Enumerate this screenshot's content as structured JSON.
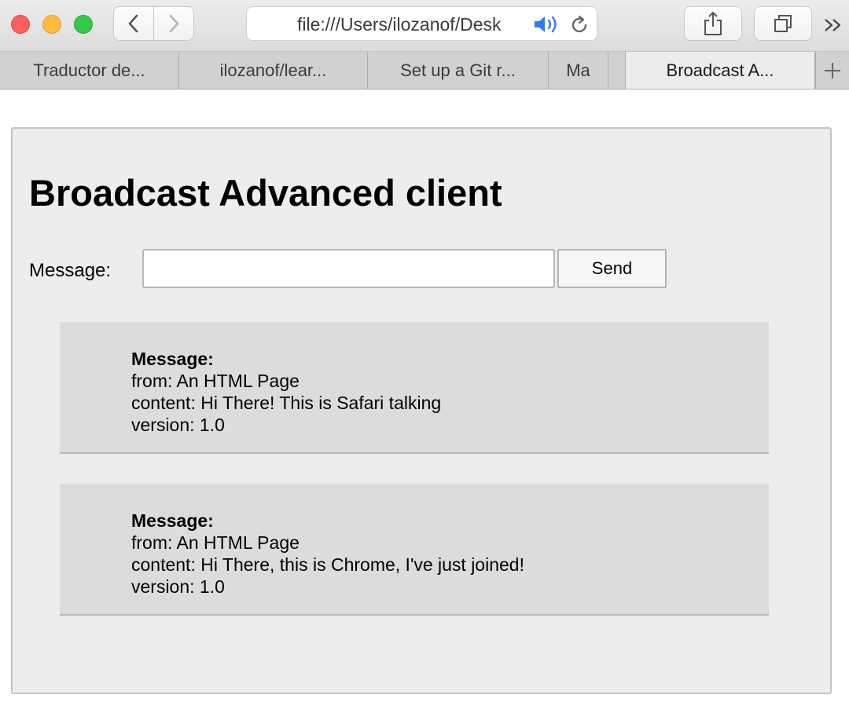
{
  "browser": {
    "address": "file:///Users/ilozanof/Desk",
    "tabs": [
      {
        "label": "Traductor de..."
      },
      {
        "label": "ilozanof/lear..."
      },
      {
        "label": "Set up a Git r..."
      },
      {
        "label": "Ma"
      },
      {
        "label": "Broadcast A...",
        "active": true
      }
    ],
    "icons": {
      "back": "chevron-left-icon",
      "forward": "chevron-right-icon",
      "sound": "speaker-icon",
      "reload": "reload-icon",
      "share": "share-icon",
      "tabs": "tab-overview-icon",
      "more": "double-chevron-right-icon",
      "new_tab": "plus-icon"
    },
    "colors": {
      "close": "#fc605c",
      "minimize": "#fdbc40",
      "zoom": "#34c84a",
      "sound_accent": "#2f7bf6"
    }
  },
  "page": {
    "title": "Broadcast Advanced client",
    "message_label": "Message:",
    "input_value": "",
    "send_label": "Send",
    "messages": [
      {
        "heading": "Message:",
        "from": "from: An HTML Page",
        "content": "content: Hi There! This is Safari talking",
        "version": "version: 1.0"
      },
      {
        "heading": "Message:",
        "from": "from: An HTML Page",
        "content": "content: Hi There, this is Chrome, I've just joined!",
        "version": "version: 1.0"
      }
    ]
  }
}
